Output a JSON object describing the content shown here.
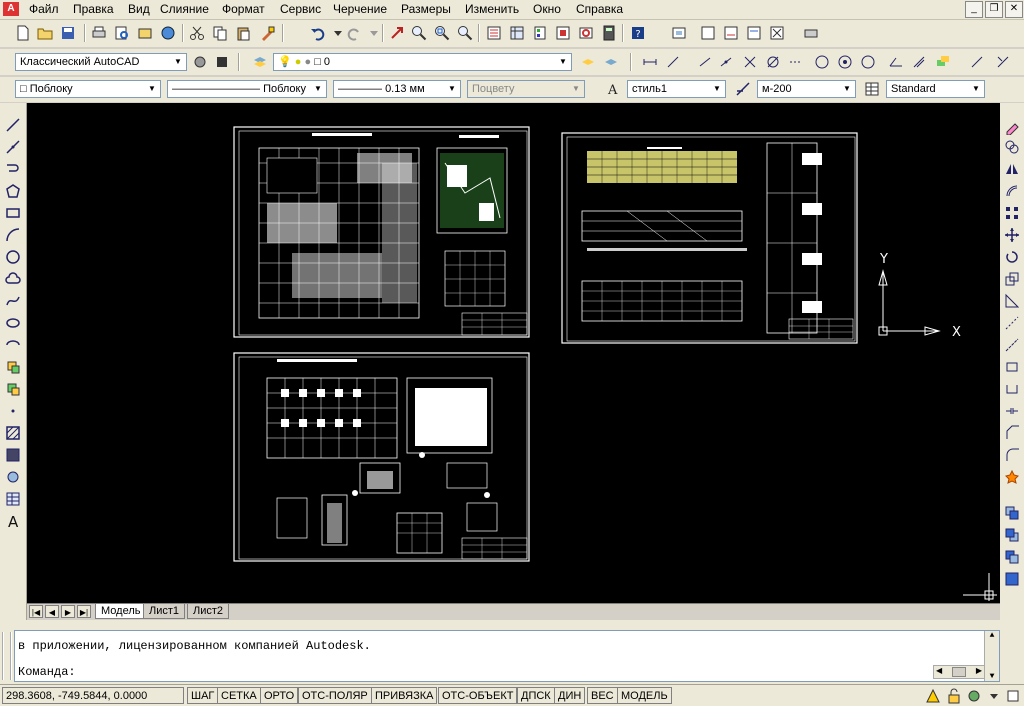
{
  "menubar": {
    "items": [
      "Файл",
      "Правка",
      "Вид",
      "Слияние",
      "Формат",
      "Сервис",
      "Черчение",
      "Размеры",
      "Изменить",
      "Окно",
      "Справка"
    ]
  },
  "toolbar2": {
    "workspace": "Классический AutoCAD",
    "layer": "0"
  },
  "toolbar3": {
    "color": "Поблоку",
    "linetype": "Поблоку",
    "lineweight": "0.13 мм",
    "plotstyle": "Поцвету",
    "textstyle": "стиль1",
    "dimstyle": "м-200",
    "tablestyle": "Standard"
  },
  "canvas": {
    "ucs_x": "X",
    "ucs_y": "Y"
  },
  "tabs": [
    "Модель",
    "Лист1",
    "Лист2"
  ],
  "command": {
    "history": "в приложении, лицензированном компанией Autodesk.",
    "prompt": "Команда:"
  },
  "status": {
    "coords": "298.3608,  -749.5844, 0.0000",
    "toggles": [
      "ШАГ",
      "СЕТКА",
      "ОРТО",
      "ОТС-ПОЛЯР",
      "ПРИВЯЗКА",
      "ОТС-ОБЪЕКТ",
      "ДПСК",
      "ДИН",
      "ВЕС",
      "МОДЕЛЬ"
    ]
  },
  "colors": {
    "canvas": "#000000",
    "chrome": "#ece9d8",
    "frame": "#d4d0c8"
  }
}
